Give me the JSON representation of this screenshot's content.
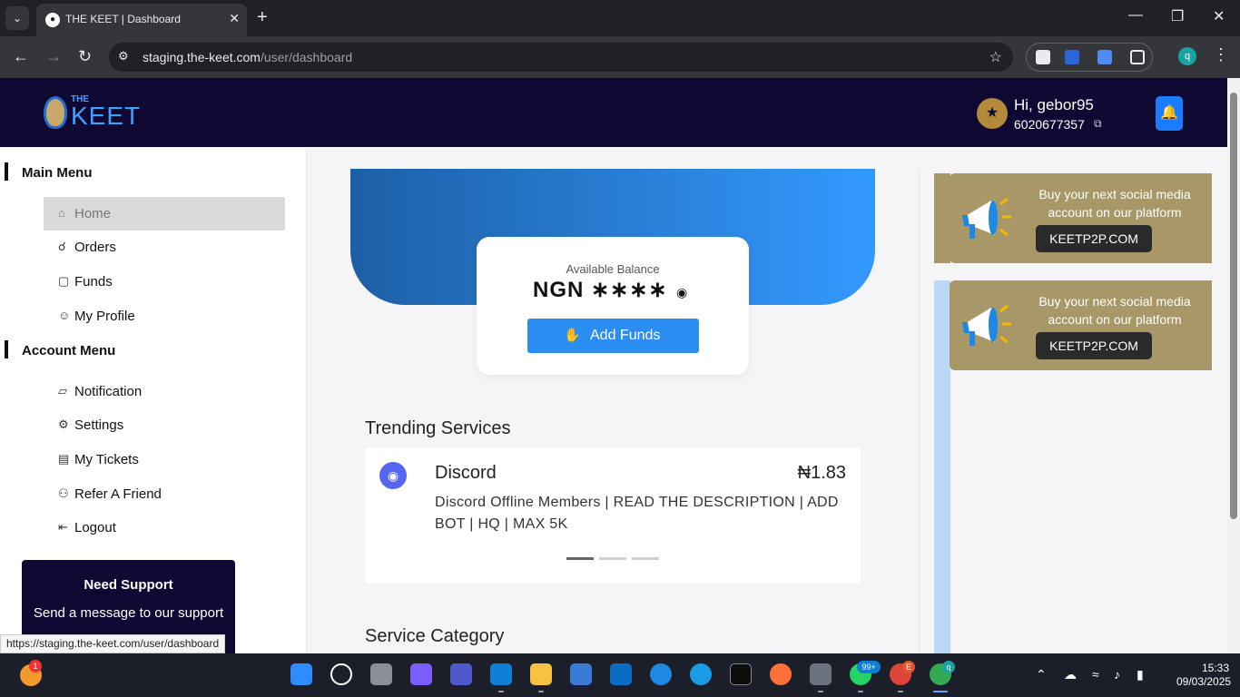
{
  "browser": {
    "tab_title": "THE KEET | Dashboard",
    "url_host": "staging.the-keet.com",
    "url_path": "/user/dashboard",
    "status_url": "https://staging.the-keet.com/user/dashboard",
    "profile_initial": "q"
  },
  "header": {
    "logo_small": "THE",
    "logo_main": "KEET",
    "greeting": "Hi, gebor95",
    "account_number": "6020677357"
  },
  "sidebar": {
    "main_heading": "Main Menu",
    "main_items": [
      {
        "label": "Home",
        "icon": "home-icon",
        "active": true
      },
      {
        "label": "Orders",
        "icon": "basket-icon"
      },
      {
        "label": "Funds",
        "icon": "wallet-icon"
      },
      {
        "label": "My Profile",
        "icon": "user-circle-icon"
      }
    ],
    "account_heading": "Account Menu",
    "account_items": [
      {
        "label": "Notification",
        "icon": "notification-icon"
      },
      {
        "label": "Settings",
        "icon": "gear-icon"
      },
      {
        "label": "My Tickets",
        "icon": "ticket-icon"
      },
      {
        "label": "Refer A Friend",
        "icon": "users-icon"
      },
      {
        "label": "Logout",
        "icon": "logout-icon"
      }
    ],
    "support": {
      "title": "Need Support",
      "text": "Send a message to our support"
    }
  },
  "balance": {
    "label": "Available Balance",
    "value": "NGN ∗∗∗∗",
    "button": "Add Funds"
  },
  "trending": {
    "title": "Trending Services",
    "service_name": "Discord",
    "price": "₦1.83",
    "description": "Discord Offline Members | READ THE DESCRIPTION | ADD BOT | HQ | MAX 5K"
  },
  "service_category_title": "Service Category",
  "ads": [
    {
      "text": "Buy your next social media account on our platform",
      "button": "KEETP2P.COM"
    },
    {
      "text": "Buy your next social media account on our platform",
      "button": "KEETP2P.COM"
    }
  ],
  "taskbar": {
    "time": "15:33",
    "date": "09/03/2025",
    "weather_badge": "1",
    "teams_badge": "99+",
    "chrome_badge": "E",
    "chrome2_badge": "q"
  },
  "colors": {
    "header_bg": "#0e0832",
    "accent": "#2b8ef2",
    "ad_bg": "#a89767"
  }
}
